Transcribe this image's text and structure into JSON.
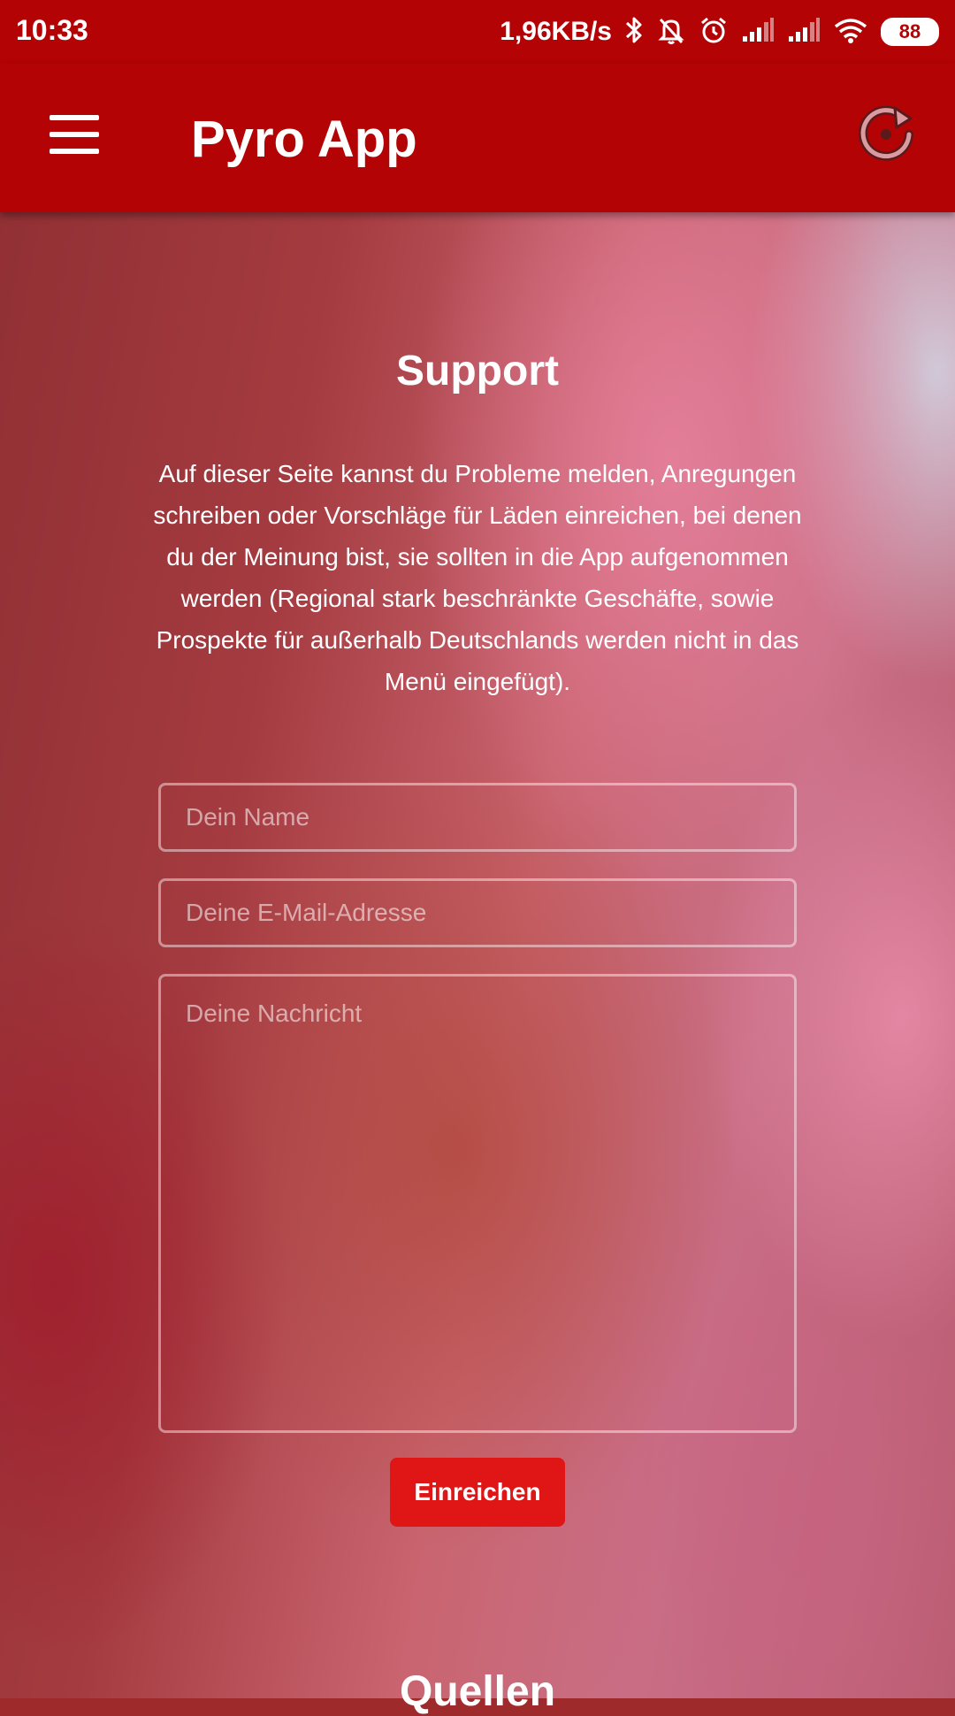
{
  "status_bar": {
    "time": "10:33",
    "network_speed": "1,96KB/s",
    "icons": [
      "bluetooth-icon",
      "muted-bell-icon",
      "alarm-icon",
      "signal-icon",
      "signal-icon",
      "wifi-icon"
    ],
    "battery_level": "88"
  },
  "app_bar": {
    "title": "Pyro App",
    "menu_icon": "hamburger-menu-icon",
    "refresh_icon": "refresh-icon"
  },
  "support": {
    "title": "Support",
    "description": "Auf dieser Seite kannst du Probleme melden, Anregungen schreiben oder Vorschläge für Läden einreichen, bei denen du der Meinung bist, sie sollten in die App aufgenommen werden (Regional stark beschränkte Geschäfte, sowie Prospekte für außerhalb Deutschlands werden nicht in das Menü eingefügt).",
    "form": {
      "name_placeholder": "Dein Name",
      "name_value": "",
      "email_placeholder": "Deine E-Mail-Adresse",
      "email_value": "",
      "message_placeholder": "Deine Nachricht",
      "message_value": "",
      "submit_label": "Einreichen"
    }
  },
  "sources": {
    "title": "Quellen"
  },
  "colors": {
    "primary": "#b30305",
    "button": "#e01515"
  }
}
